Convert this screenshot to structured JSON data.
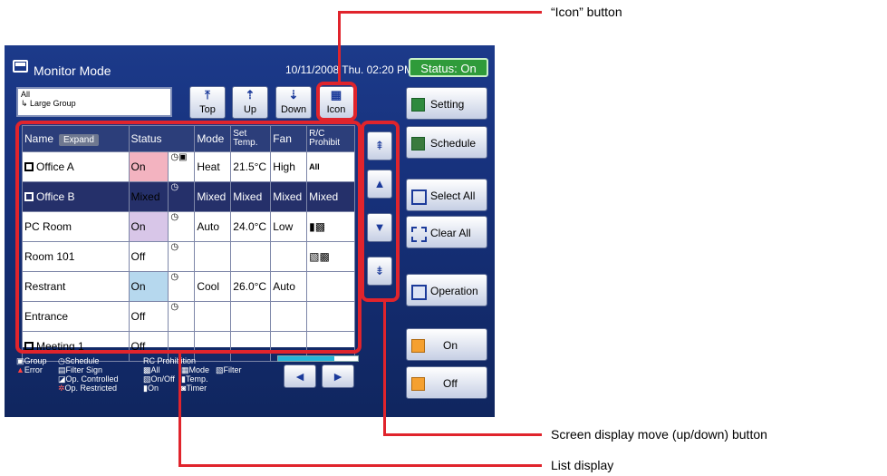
{
  "header": {
    "title": "Monitor Mode",
    "datetime": "10/11/2008 Thu. 02:20 PM",
    "status": "Status: On"
  },
  "group": {
    "line1": "All",
    "line2": "↳ Large Group"
  },
  "nav": {
    "top": "Top",
    "up": "Up",
    "down": "Down",
    "icon": "Icon"
  },
  "table": {
    "headers": {
      "name": "Name",
      "expand": "Expand",
      "status": "Status",
      "mode": "Mode",
      "settemp": "Set Temp.",
      "fan": "Fan",
      "rc": "R/C Prohibit"
    },
    "rows": [
      {
        "name": "Office A",
        "status": "On",
        "mode": "Heat",
        "temp": "21.5°C",
        "fan": "High",
        "rc": "All"
      },
      {
        "name": "Office B",
        "status": "Mixed",
        "mode": "Mixed",
        "temp": "Mixed",
        "fan": "Mixed",
        "rc": "Mixed"
      },
      {
        "name": "PC Room",
        "status": "On",
        "mode": "Auto",
        "temp": "24.0°C",
        "fan": "Low",
        "rc": ""
      },
      {
        "name": "Room 101",
        "status": "Off",
        "mode": "",
        "temp": "",
        "fan": "",
        "rc": ""
      },
      {
        "name": "Restrant",
        "status": "On",
        "mode": "Cool",
        "temp": "26.0°C",
        "fan": "Auto",
        "rc": ""
      },
      {
        "name": "Entrance",
        "status": "Off",
        "mode": "",
        "temp": "",
        "fan": "",
        "rc": ""
      },
      {
        "name": "Meeting 1",
        "status": "Off",
        "mode": "",
        "temp": "",
        "fan": "",
        "rc": ""
      }
    ]
  },
  "side": {
    "setting": "Setting",
    "schedule": "Schedule",
    "select_all": "Select All",
    "clear_all": "Clear All",
    "operation": "Operation",
    "on": "On",
    "off": "Off"
  },
  "legend": {
    "col1": [
      "Group",
      "Error"
    ],
    "col2": [
      "Schedule",
      "Filter Sign",
      "Op. Controlled",
      "Op. Restricted"
    ],
    "rc_title": "RC Prohibition",
    "col3": [
      "All",
      "On/Off",
      "On"
    ],
    "col4": [
      "Mode",
      "Temp.",
      "Timer"
    ],
    "col5": [
      "Filter"
    ]
  },
  "progress": 0.7,
  "callouts": {
    "icon_button": "“Icon” button",
    "screen_move": "Screen display move (up/down) button",
    "list_display": "List display"
  },
  "colors": {
    "accent_red": "#e0242c",
    "screen_blue": "#16307a",
    "status_green": "#2f9b3a"
  }
}
